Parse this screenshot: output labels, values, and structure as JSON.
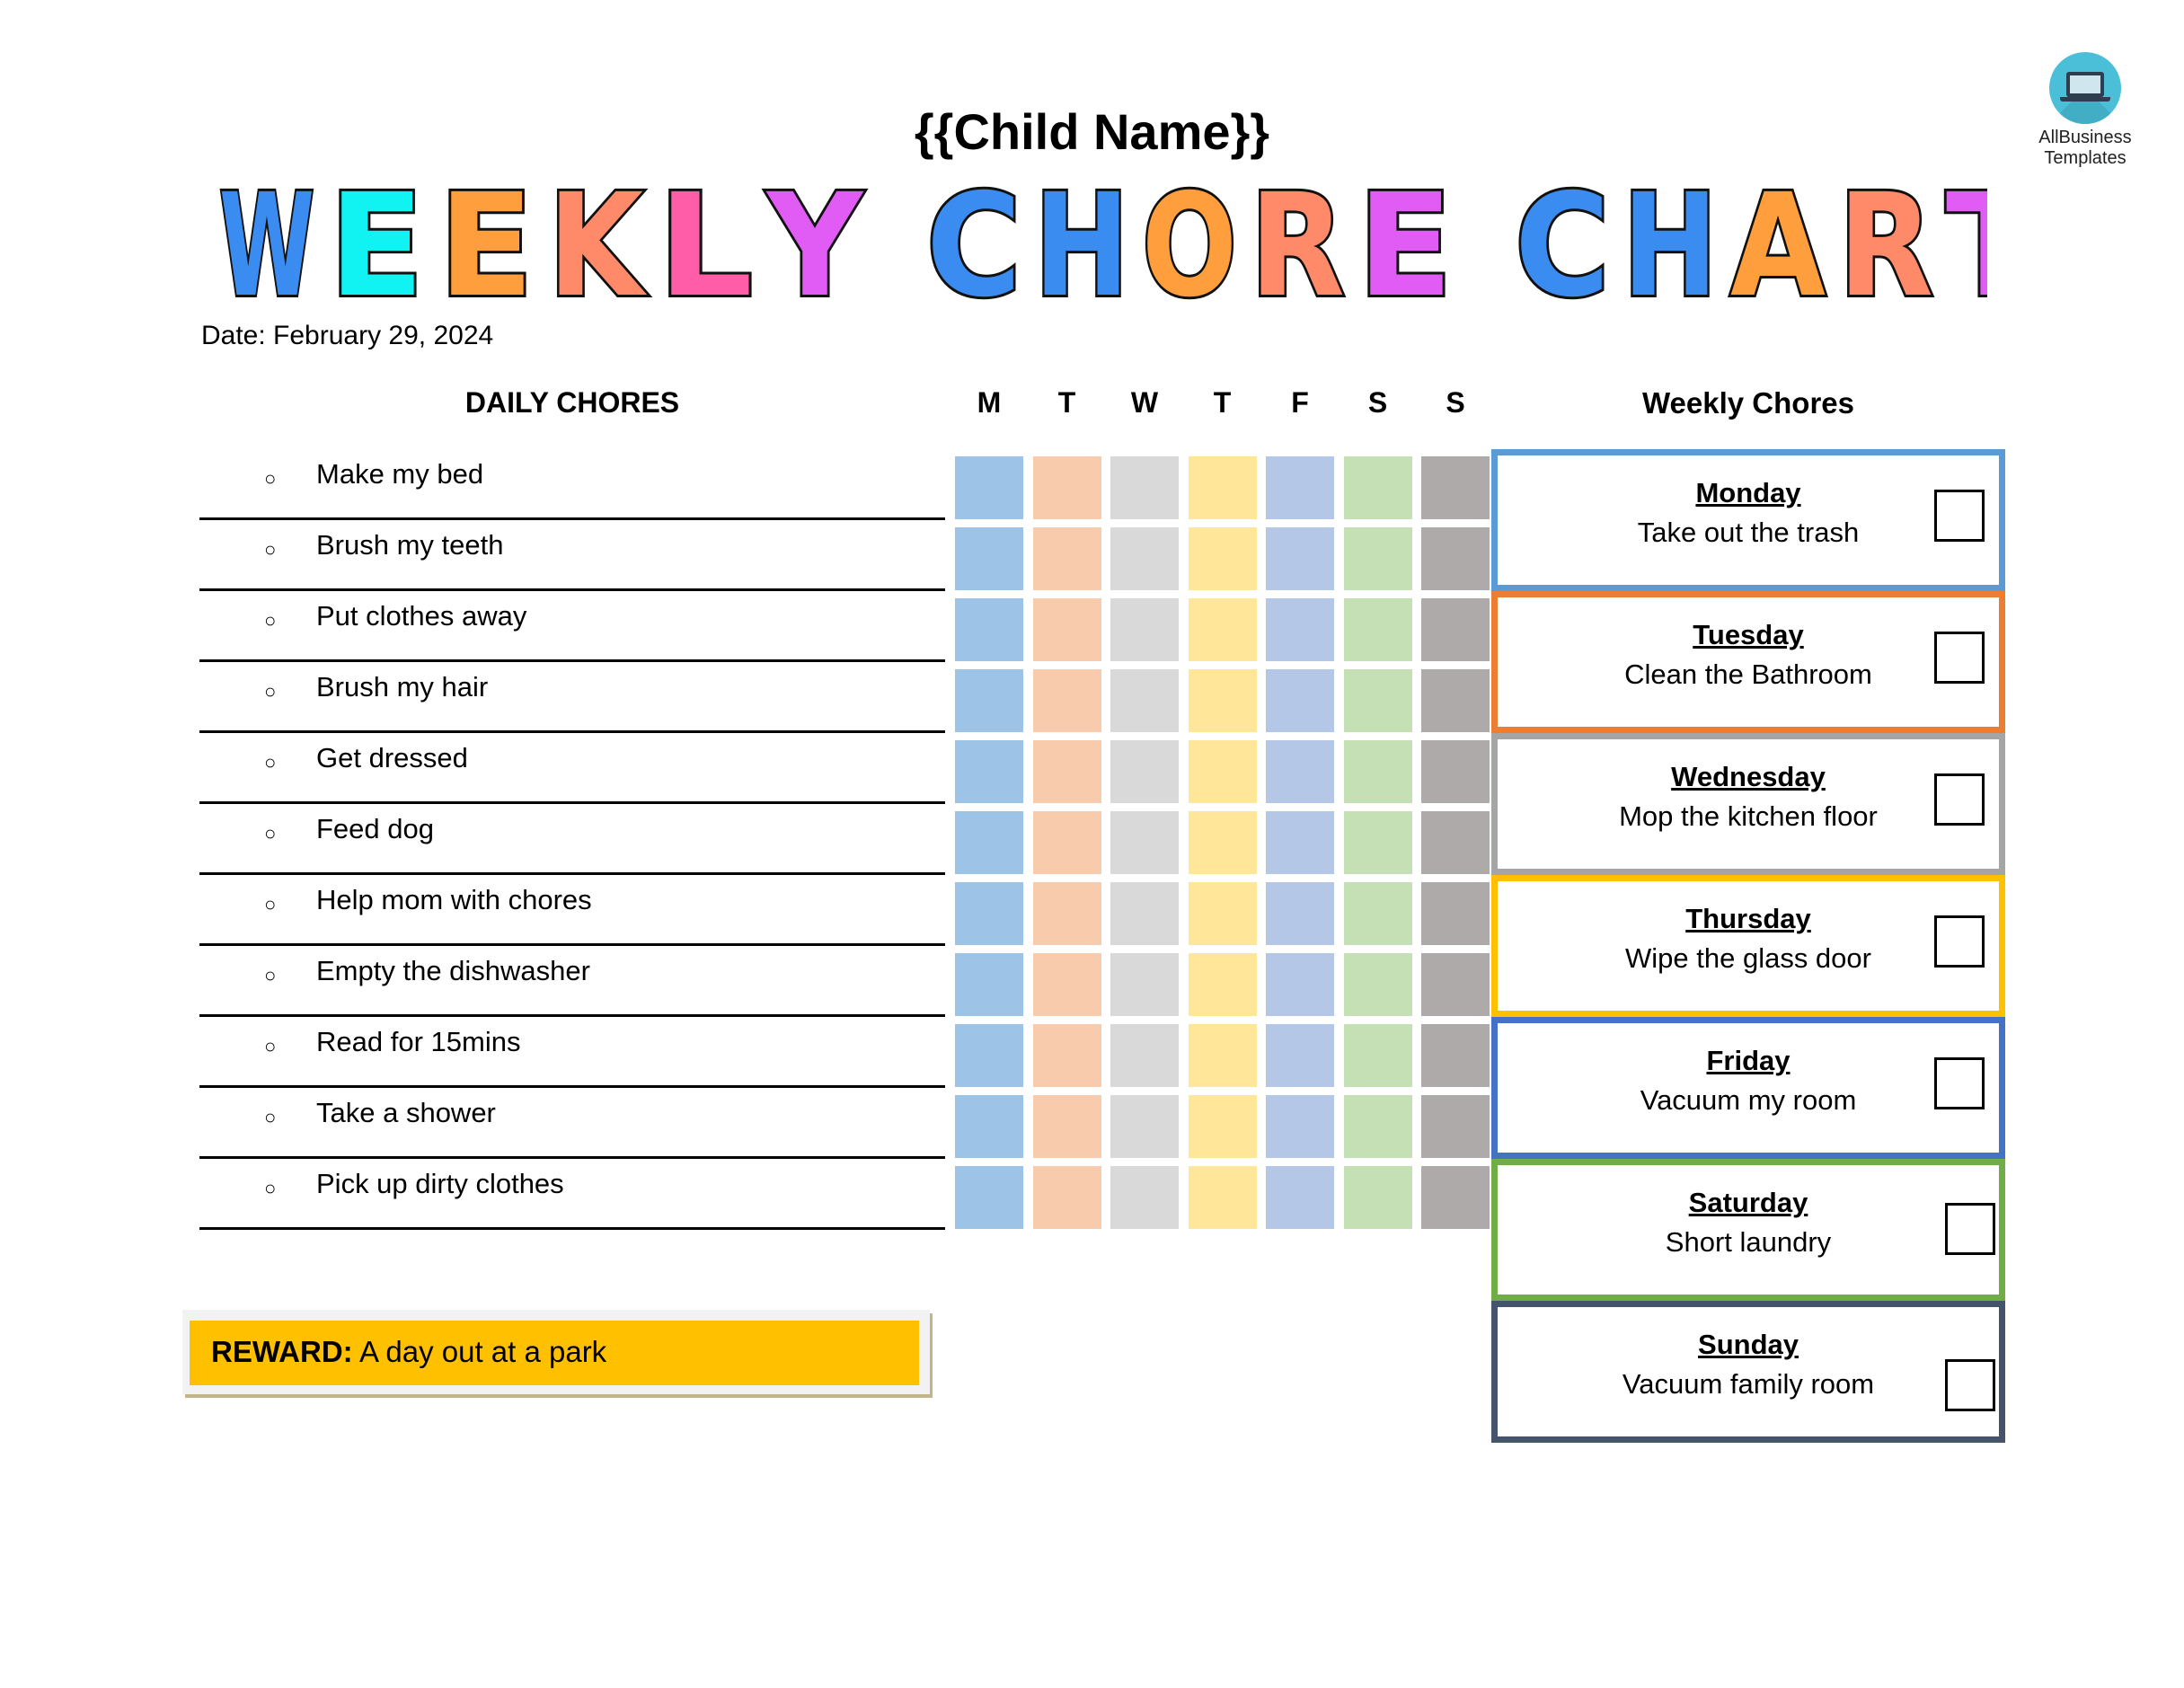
{
  "logo": {
    "line1": "AllBusiness",
    "line2": "Templates",
    "icon": "laptop-icon",
    "color": "#4BBFD8"
  },
  "child_name": "{{Child Name}}",
  "title": {
    "words": [
      {
        "word": "WEEKLY",
        "letters": [
          {
            "ch": "W",
            "color": "#3A8CF0"
          },
          {
            "ch": "E",
            "color": "#11F2F2"
          },
          {
            "ch": "E",
            "color": "#FF9E3D"
          },
          {
            "ch": "K",
            "color": "#FF8A6A"
          },
          {
            "ch": "L",
            "color": "#FF5DA8"
          },
          {
            "ch": "Y",
            "color": "#E05CF5"
          }
        ]
      },
      {
        "word": "CHORE",
        "letters": [
          {
            "ch": "C",
            "color": "#3A8CF0"
          },
          {
            "ch": "H",
            "color": "#3A8CF0"
          },
          {
            "ch": "O",
            "color": "#FF9E3D"
          },
          {
            "ch": "R",
            "color": "#FF8A6A"
          },
          {
            "ch": "E",
            "color": "#E05CF5"
          }
        ]
      },
      {
        "word": "CHART",
        "letters": [
          {
            "ch": "C",
            "color": "#3A8CF0"
          },
          {
            "ch": "H",
            "color": "#3A8CF0"
          },
          {
            "ch": "A",
            "color": "#FF9E3D"
          },
          {
            "ch": "R",
            "color": "#FF8A6A"
          },
          {
            "ch": "T",
            "color": "#E05CF5"
          }
        ]
      }
    ]
  },
  "date": "Date: February 29, 2024",
  "daily": {
    "header": "DAILY CHORES",
    "bullet": "○",
    "chores": [
      "Make my bed",
      "Brush my teeth",
      "Put clothes away",
      "Brush my hair",
      "Get dressed",
      "Feed dog",
      "Help mom with chores",
      "Empty the dishwasher",
      "Read for 15mins",
      "Take a shower",
      "Pick up dirty clothes"
    ]
  },
  "days": [
    {
      "letter": "M",
      "color": "#9DC3E6"
    },
    {
      "letter": "T",
      "color": "#F8CBAD"
    },
    {
      "letter": "W",
      "color": "#D9D9D9"
    },
    {
      "letter": "T",
      "color": "#FFE699"
    },
    {
      "letter": "F",
      "color": "#B4C7E7"
    },
    {
      "letter": "S",
      "color": "#C5E0B4"
    },
    {
      "letter": "S",
      "color": "#AEAAAA"
    }
  ],
  "weekly": {
    "header": "Weekly Chores",
    "items": [
      {
        "day": "Monday",
        "task": "Take out the trash",
        "color": "#5B9BD5"
      },
      {
        "day": "Tuesday",
        "task": "Clean the Bathroom",
        "color": "#ED7D31"
      },
      {
        "day": "Wednesday",
        "task": "Mop the kitchen floor",
        "color": "#A5A5A5"
      },
      {
        "day": "Thursday",
        "task": "Wipe the glass door",
        "color": "#FFC000"
      },
      {
        "day": "Friday",
        "task": "Vacuum my room",
        "color": "#4472C4"
      },
      {
        "day": "Saturday",
        "task": "Short laundry",
        "color": "#70AD47"
      },
      {
        "day": "Sunday",
        "task": "Vacuum family room",
        "color": "#44546A"
      }
    ]
  },
  "reward": {
    "label": "REWARD:",
    "text": " A day out at a park",
    "color": "#FFC000"
  }
}
